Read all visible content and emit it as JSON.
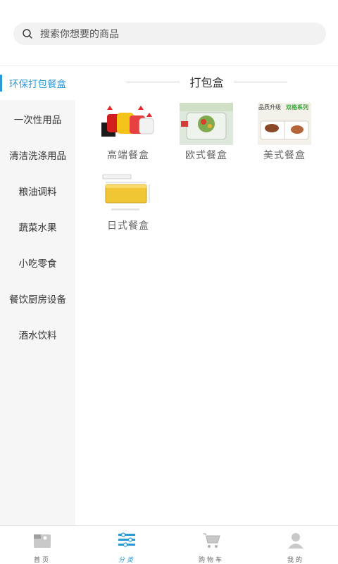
{
  "search": {
    "placeholder": "搜索你想要的商品"
  },
  "sidebar": {
    "items": [
      {
        "label": "环保打包餐盒",
        "active": true
      },
      {
        "label": "一次性用品",
        "active": false
      },
      {
        "label": "清洁洗涤用品",
        "active": false
      },
      {
        "label": "粮油调料",
        "active": false
      },
      {
        "label": "蔬菜水果",
        "active": false
      },
      {
        "label": "小吃零食",
        "active": false
      },
      {
        "label": "餐饮厨房设备",
        "active": false
      },
      {
        "label": "酒水饮料",
        "active": false
      }
    ]
  },
  "section": {
    "title": "打包盒",
    "products": [
      {
        "name": "高端餐盒",
        "image": "red-yellow-containers"
      },
      {
        "name": "欧式餐盒",
        "image": "clear-salad-box"
      },
      {
        "name": "美式餐盒",
        "image": "white-compartment-box",
        "overlay_left": "品质升级",
        "overlay_right": "双格系列"
      },
      {
        "name": "日式餐盒",
        "image": "yellow-rect-box"
      }
    ]
  },
  "accent_color": "#2a9ad6",
  "tabs": [
    {
      "label": "首页",
      "icon": "home-icon",
      "active": false
    },
    {
      "label": "分类",
      "icon": "category-icon",
      "active": true
    },
    {
      "label": "购物车",
      "icon": "cart-icon",
      "active": false
    },
    {
      "label": "我的",
      "icon": "user-icon",
      "active": false
    }
  ]
}
